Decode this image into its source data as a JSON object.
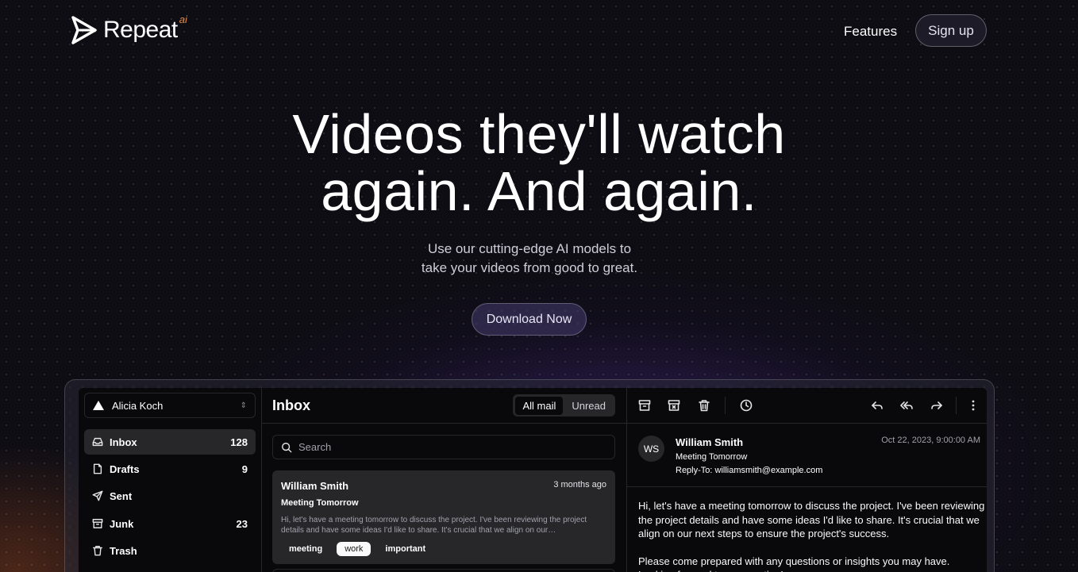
{
  "brand": {
    "name": "Repeat",
    "suffix": "ai",
    "accent": "#e8893b"
  },
  "nav": {
    "features": "Features",
    "signup": "Sign up"
  },
  "hero": {
    "title_line1": "Videos they'll watch",
    "title_line2": "again. And again.",
    "sub_line1": "Use our cutting-edge AI models to",
    "sub_line2": "take your videos from good to great.",
    "cta": "Download Now"
  },
  "app": {
    "account": "Alicia Koch",
    "folders": [
      {
        "label": "Inbox",
        "count": "128",
        "icon": "inbox-icon"
      },
      {
        "label": "Drafts",
        "count": "9",
        "icon": "file-icon"
      },
      {
        "label": "Sent",
        "count": "",
        "icon": "send-icon"
      },
      {
        "label": "Junk",
        "count": "23",
        "icon": "archive-icon"
      },
      {
        "label": "Trash",
        "count": "",
        "icon": "trash-icon"
      }
    ],
    "list": {
      "title": "Inbox",
      "filters": [
        "All mail",
        "Unread"
      ],
      "search_placeholder": "Search",
      "mails": [
        {
          "from": "William Smith",
          "date": "3 months ago",
          "subject": "Meeting Tomorrow",
          "preview": "Hi, let's have a meeting tomorrow to discuss the project. I've been reviewing the project details and have some ideas I'd like to share. It's crucial that we align on our…",
          "tags": [
            "meeting",
            "work",
            "important"
          ]
        }
      ]
    },
    "reader": {
      "initials": "WS",
      "from": "William Smith",
      "subject": "Meeting Tomorrow",
      "reply_to": "Reply-To: williamsmith@example.com",
      "date": "Oct 22, 2023, 9:00:00 AM",
      "body_p1": "Hi, let's have a meeting tomorrow to discuss the project. I've been reviewing the project details and have some ideas I'd like to share. It's crucial that we align on our next steps to ensure the project's success.",
      "body_p2": "Please come prepared with any questions or insights you may have. Looking forward to our meeting!"
    }
  }
}
